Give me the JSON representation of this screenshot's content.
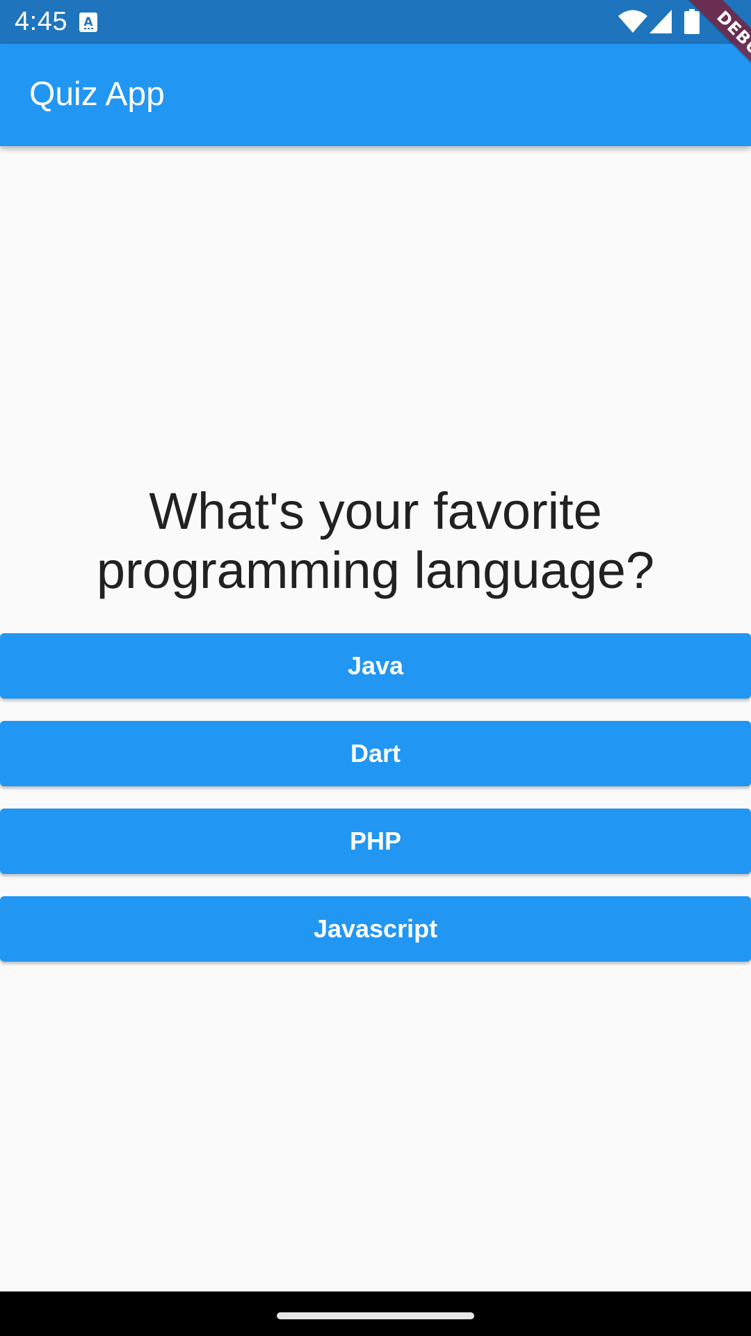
{
  "status_bar": {
    "time": "4:45",
    "notification_icon": "text-a-icon",
    "wifi_icon": "wifi-icon",
    "signal_icon": "cell-signal-icon",
    "battery_icon": "battery-icon"
  },
  "app_bar": {
    "title": "Quiz App",
    "color": "#2196f3"
  },
  "debug_banner": {
    "label": "DEBUG"
  },
  "quiz": {
    "question": "What's your favorite programming language?",
    "answers": [
      {
        "label": "Java"
      },
      {
        "label": "Dart"
      },
      {
        "label": "PHP"
      },
      {
        "label": "Javascript"
      }
    ]
  },
  "colors": {
    "primary": "#2196f3",
    "status_bar": "#1e74bd",
    "background": "#fafafa",
    "text": "#212121"
  }
}
